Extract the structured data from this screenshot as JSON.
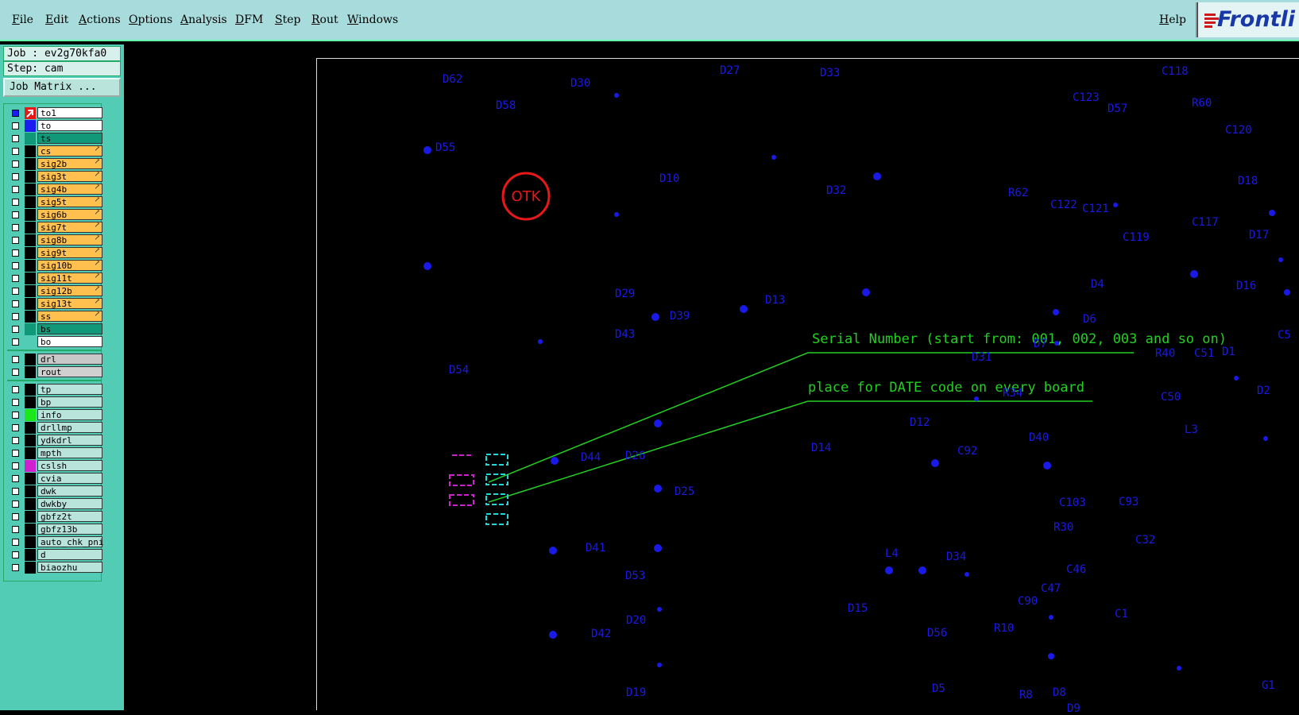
{
  "menubar": {
    "file": "File",
    "edit": "Edit",
    "actions": "Actions",
    "options": "Options",
    "analysis": "Analysis",
    "dfm": "DFM",
    "step": "Step",
    "rout": "Rout",
    "windows": "Windows",
    "help": "Help"
  },
  "logo": {
    "text": "Frontli"
  },
  "job": {
    "label": "Job : ev2g70kfa0",
    "step": "Step: cam",
    "matrix_button": "Job Matrix ..."
  },
  "layers": [
    {
      "name": "to1"
    },
    {
      "name": "to"
    },
    {
      "name": "ts"
    },
    {
      "name": "cs"
    },
    {
      "name": "sig2b"
    },
    {
      "name": "sig3t"
    },
    {
      "name": "sig4b"
    },
    {
      "name": "sig5t"
    },
    {
      "name": "sig6b"
    },
    {
      "name": "sig7t"
    },
    {
      "name": "sig8b"
    },
    {
      "name": "sig9t"
    },
    {
      "name": "sig10b"
    },
    {
      "name": "sig11t"
    },
    {
      "name": "sig12b"
    },
    {
      "name": "sig13t"
    },
    {
      "name": "ss"
    },
    {
      "name": "bs"
    },
    {
      "name": "bo"
    },
    {
      "name": "drl"
    },
    {
      "name": "rout"
    },
    {
      "name": "tp"
    },
    {
      "name": "bp"
    },
    {
      "name": "info"
    },
    {
      "name": "drllmp"
    },
    {
      "name": "ydkdrl"
    },
    {
      "name": "mpth"
    },
    {
      "name": "cslsh"
    },
    {
      "name": "cvia"
    },
    {
      "name": "dwk"
    },
    {
      "name": "dwkby"
    },
    {
      "name": "gbfz2t"
    },
    {
      "name": "gbfz13b"
    },
    {
      "name": "auto_chk_pni"
    },
    {
      "name": "d"
    },
    {
      "name": "biaozhu"
    }
  ],
  "canvas": {
    "otk_label": "OTK",
    "note_serial": "Serial Number (start from: 001, 002, 003 and so on)",
    "note_date": "place for DATE code on every board",
    "refdes": [
      "D62",
      "D30",
      "D27",
      "D33",
      "C118",
      "D58",
      "C123",
      "D57",
      "R60",
      "D55",
      "C120",
      "D10",
      "D32",
      "R62",
      "C122",
      "C121",
      "D18",
      "C119",
      "C117",
      "D17",
      "D29",
      "D13",
      "D4",
      "D16",
      "D39",
      "D6",
      "D43",
      "C5",
      "D7",
      "R40",
      "C51",
      "D31",
      "D1",
      "D54",
      "R34",
      "D2",
      "C50",
      "D12",
      "L3",
      "D40",
      "D14",
      "C92",
      "D44",
      "D26",
      "D25",
      "C103",
      "C93",
      "R30",
      "D41",
      "C32",
      "L4",
      "D34",
      "C46",
      "D53",
      "C47",
      "C90",
      "D15",
      "C1",
      "D20",
      "D56",
      "R10",
      "D42",
      "D5",
      "G1",
      "D19",
      "R8",
      "D8",
      "D9"
    ]
  },
  "colors": {
    "menubar": "#a8dcdc",
    "panel": "#52ccb4",
    "canvas": "#000000",
    "refdes": "#1a1ae8",
    "note": "#22d022",
    "otk": "#e81818"
  }
}
